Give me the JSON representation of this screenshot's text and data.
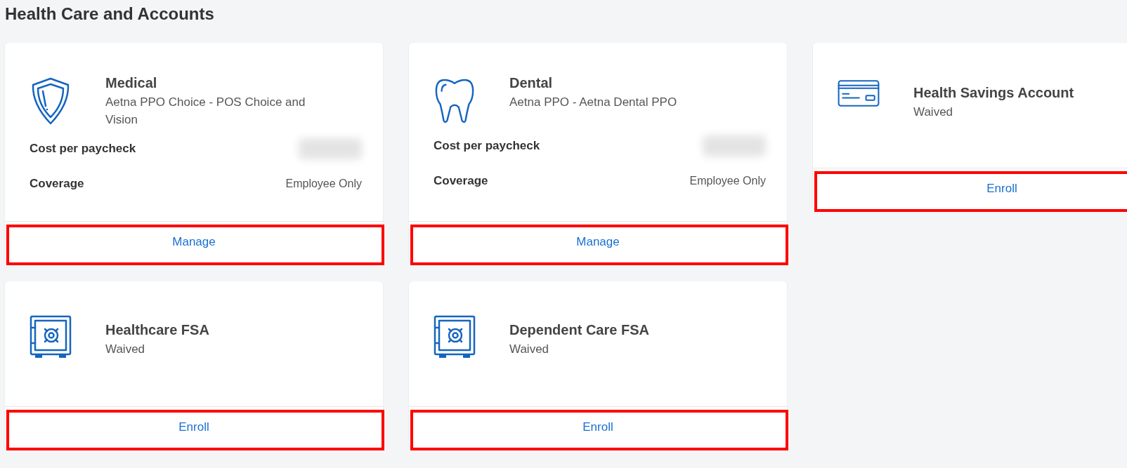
{
  "page_title": "Health Care and Accounts",
  "cards": [
    {
      "kind": "shield",
      "title": "Medical",
      "subtitle": "Aetna PPO Choice - POS Choice and Vision",
      "details": [
        {
          "label": "Cost per paycheck",
          "value_redacted": true
        },
        {
          "label": "Coverage",
          "value": "Employee Only"
        }
      ],
      "action": {
        "label": "Manage",
        "highlighted": true
      }
    },
    {
      "kind": "tooth",
      "title": "Dental",
      "subtitle": "Aetna PPO - Aetna Dental PPO",
      "details": [
        {
          "label": "Cost per paycheck",
          "value_redacted": true
        },
        {
          "label": "Coverage",
          "value": "Employee Only"
        }
      ],
      "action": {
        "label": "Manage",
        "highlighted": true
      }
    },
    {
      "kind": "card",
      "title": "Health Savings Account",
      "subtitle": "Waived",
      "action": {
        "label": "Enroll",
        "highlighted": true
      }
    },
    {
      "kind": "safe",
      "title": "Healthcare FSA",
      "subtitle": "Waived",
      "action": {
        "label": "Enroll",
        "highlighted": true
      }
    },
    {
      "kind": "safe",
      "title": "Dependent Care FSA",
      "subtitle": "Waived",
      "action": {
        "label": "Enroll",
        "highlighted": true
      }
    }
  ]
}
